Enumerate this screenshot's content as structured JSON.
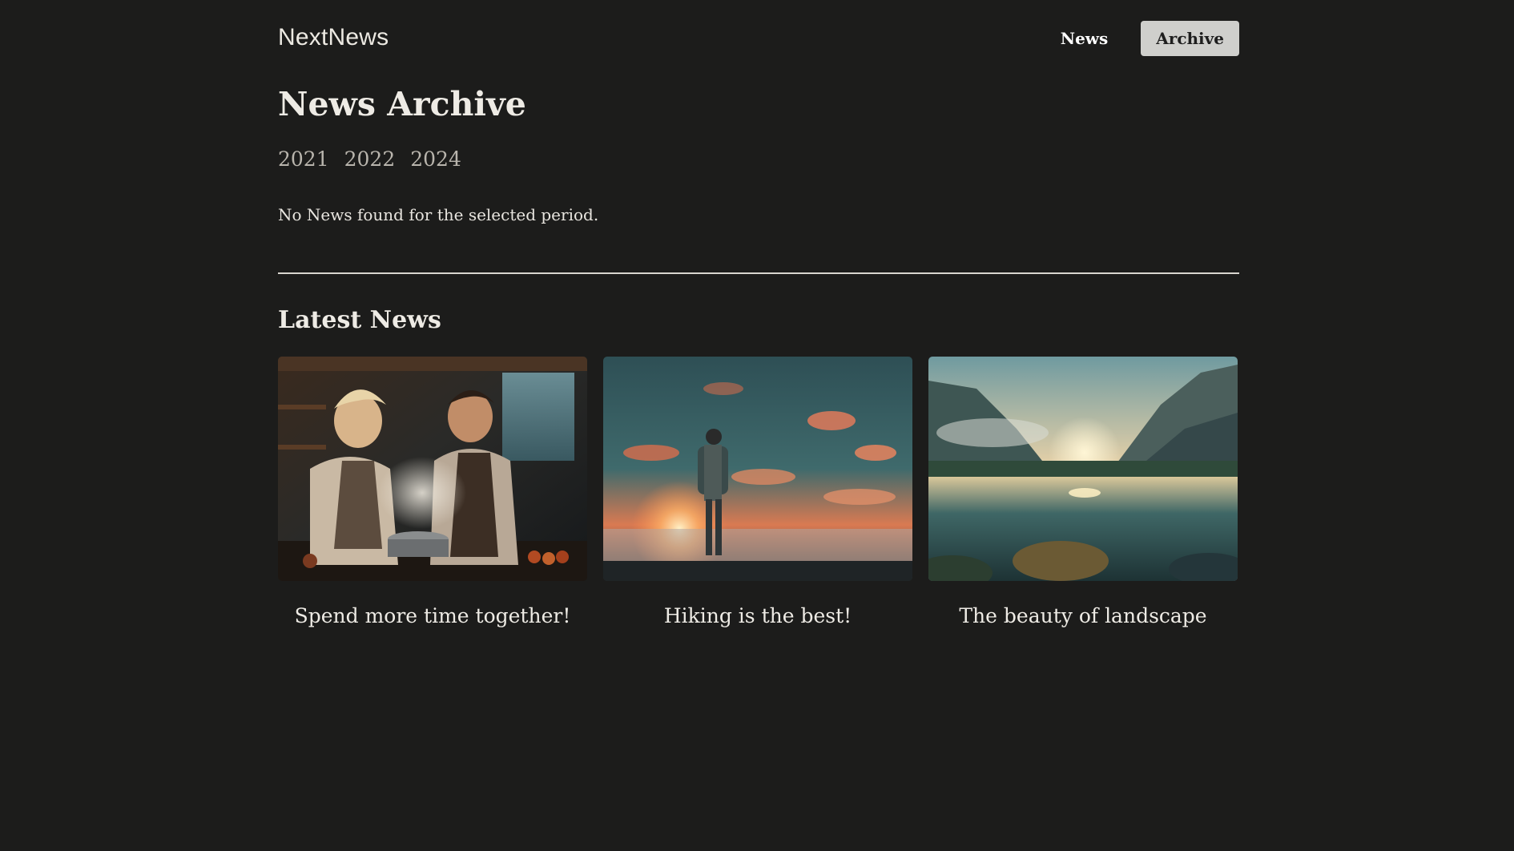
{
  "header": {
    "logo": "NextNews",
    "nav": [
      {
        "label": "News",
        "active": false
      },
      {
        "label": "Archive",
        "active": true
      }
    ]
  },
  "archive": {
    "title": "News Archive",
    "years": [
      "2021",
      "2022",
      "2024"
    ],
    "empty_message": "No News found for the selected period."
  },
  "latest": {
    "title": "Latest News",
    "cards": [
      {
        "title": "Spend more time together!",
        "image": "couple-cooking-kitchen-photo"
      },
      {
        "title": "Hiking is the best!",
        "image": "hiker-sunset-clouds-photo"
      },
      {
        "title": "The beauty of landscape",
        "image": "mountain-lake-landscape-photo"
      }
    ]
  },
  "colors": {
    "background": "#1c1c1b",
    "text": "#eeebe5",
    "nav_active_bg": "#cfcfcc",
    "year_link": "#b9b5ad"
  }
}
